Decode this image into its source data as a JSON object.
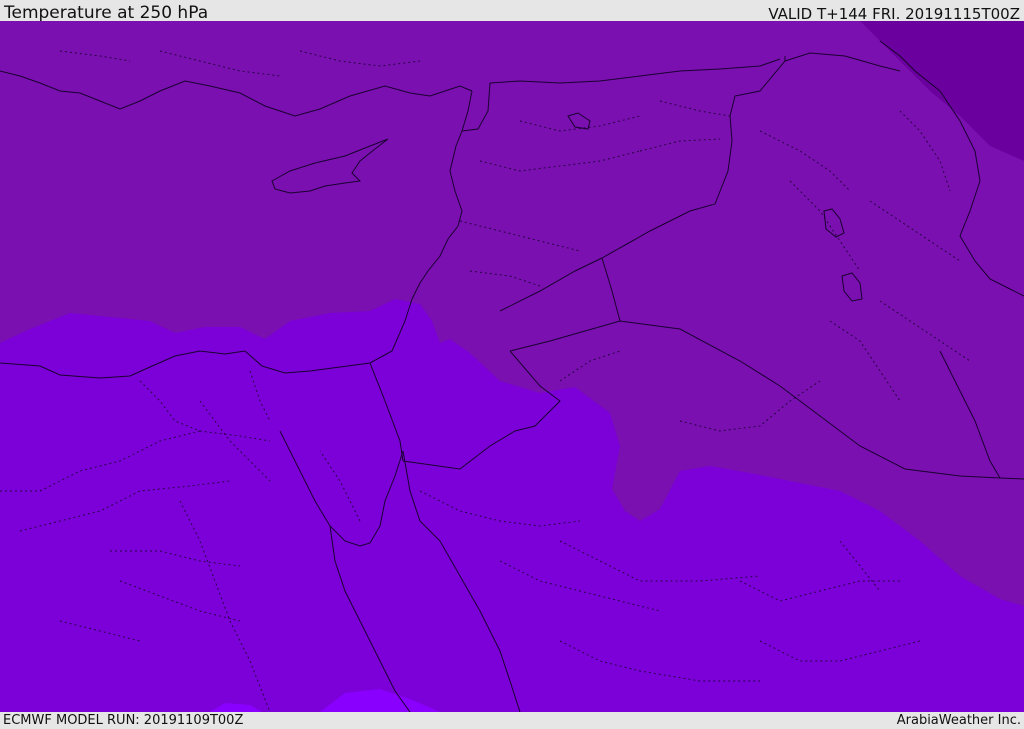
{
  "header": {
    "title": "Temperature at 250 hPa",
    "valid_time": "VALID T+144 FRI. 20191115T00Z"
  },
  "footer": {
    "model_run": "ECMWF MODEL RUN: 20191109T00Z",
    "credit": "ArabiaWeather Inc."
  },
  "map": {
    "region": "Eastern Mediterranean and Middle East",
    "colors": {
      "dark_band": "#6a009e",
      "mid_band": "#7a10b0",
      "cool_band": "#7c00d8",
      "light_band": "#8a00ff",
      "border_line": "#1a0030"
    }
  }
}
